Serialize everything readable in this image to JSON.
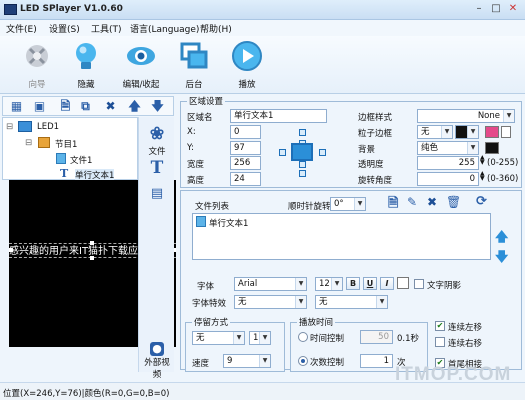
{
  "app": {
    "title": "LED SPlayer V1.0.60"
  },
  "menu": [
    "文件(E)",
    "设置(S)",
    "工具(T)",
    "语言(Language)",
    "帮助(H)"
  ],
  "toolbar": [
    {
      "label": "向导",
      "enabled": false,
      "icon": "wizard-icon"
    },
    {
      "label": "隐藏",
      "enabled": true,
      "icon": "lightbulb-icon"
    },
    {
      "label": "编辑/收起",
      "enabled": true,
      "icon": "eye-icon"
    },
    {
      "label": "后台",
      "enabled": true,
      "icon": "window-icon"
    },
    {
      "label": "播放",
      "enabled": true,
      "icon": "play-icon"
    }
  ],
  "tree": {
    "root": "LED1",
    "program": "节目1",
    "file": "文件1",
    "item": "单行文本1"
  },
  "preview": {
    "text": "感兴趣的用户来IT猫扑下载应用！欢"
  },
  "sidebar": [
    {
      "label": "文件",
      "icon": "palette-icon"
    },
    {
      "label": "",
      "icon": "text-icon"
    },
    {
      "label": "外部视频",
      "icon": "external-video-icon"
    }
  ],
  "area": {
    "title": "区域设置",
    "name_label": "区域名",
    "name_value": "单行文本1",
    "x_label": "X:",
    "x_value": "0",
    "y_label": "Y:",
    "y_value": "97",
    "w_label": "宽度",
    "w_value": "256",
    "h_label": "高度",
    "h_value": "24",
    "border_style_label": "边框样式",
    "border_style_value": "None",
    "particle_border_label": "粒子边框",
    "particle_border_value": "无",
    "bg_label": "背景",
    "bg_value": "纯色",
    "transparency_label": "透明度",
    "transparency_value": "255",
    "transparency_range": "(0-255)",
    "rotation_label": "旋转角度",
    "rotation_value": "0",
    "rotation_range": "(0-360)",
    "colors": {
      "particle_swatch": "#e44a8a",
      "bg_swatch": "#111111"
    }
  },
  "files": {
    "title": "文件列表",
    "rotate_label": "顺时针旋转",
    "rotate_value": "0°",
    "items": [
      "单行文本1"
    ]
  },
  "font": {
    "font_label": "字体",
    "font_value": "Arial",
    "size_value": "12",
    "bold": "B",
    "underline": "U",
    "italic": "I",
    "shadow_label": "文字阴影",
    "effect_label": "字体特效",
    "effect_value": "无",
    "effect2_value": "无"
  },
  "stay": {
    "title": "停留方式",
    "mode_value": "无",
    "count_value": "1",
    "speed_label": "速度",
    "speed_value": "9"
  },
  "playtime": {
    "title": "播放时间",
    "time_label": "时间控制",
    "time_value": "50",
    "time_unit": "0.1秒",
    "count_label": "次数控制",
    "count_value": "1",
    "count_unit": "次",
    "mode": "count"
  },
  "options": [
    {
      "label": "连续左移",
      "checked": true
    },
    {
      "label": "连续右移",
      "checked": false
    },
    {
      "label": "首尾相接",
      "checked": true
    }
  ],
  "status": {
    "text": "位置(X=246,Y=76)|颜色(R=0,G=0,B=0)"
  },
  "watermark": "ITMOP.COM"
}
